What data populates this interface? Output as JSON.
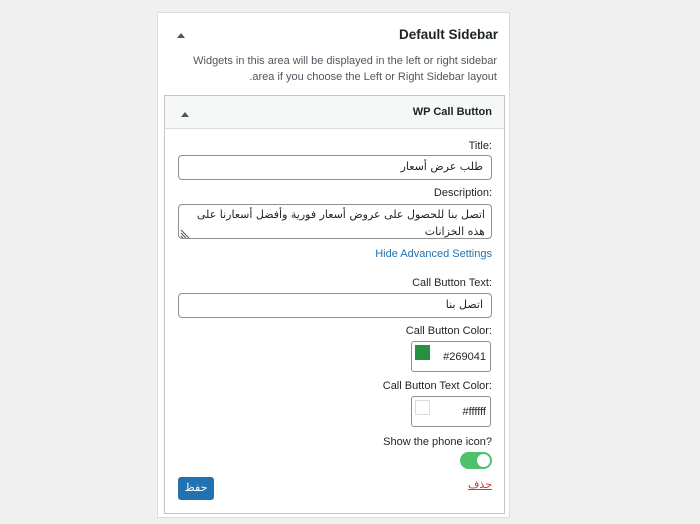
{
  "sidebar": {
    "title": "Default Sidebar",
    "description": "Widgets in this area will be displayed in the left or right sidebar area if you choose the Left or Right Sidebar layout.",
    "toggle_icon": "triangle-up-icon"
  },
  "widget": {
    "title": "WP Call Button",
    "toggle_icon": "triangle-up-icon",
    "fields": {
      "title_label": "Title:",
      "title_value": "طلب عرض أسعار",
      "description_label": "Description:",
      "description_value": "اتصل بنا للحصول على عروض أسعار فورية وأفضل أسعارنا على هذه الخزانات",
      "advanced_link": "Hide Advanced Settings",
      "call_text_label": "Call Button Text:",
      "call_text_value": "اتصل بنا",
      "call_color_label": "Call Button Color:",
      "call_color_value": "#269041",
      "call_text_color_label": "Call Button Text Color:",
      "call_text_color_value": "#ffffff",
      "phone_icon_label": "Show the phone icon?",
      "phone_icon_enabled": true
    },
    "actions": {
      "delete_label": "حذف",
      "save_label": "حفظ"
    }
  },
  "colors": {
    "accent": "#2271b1",
    "toggle_on": "#4ec26b",
    "call_swatch": "#269041",
    "text_swatch": "#ffffff",
    "delete": "#d63638"
  }
}
